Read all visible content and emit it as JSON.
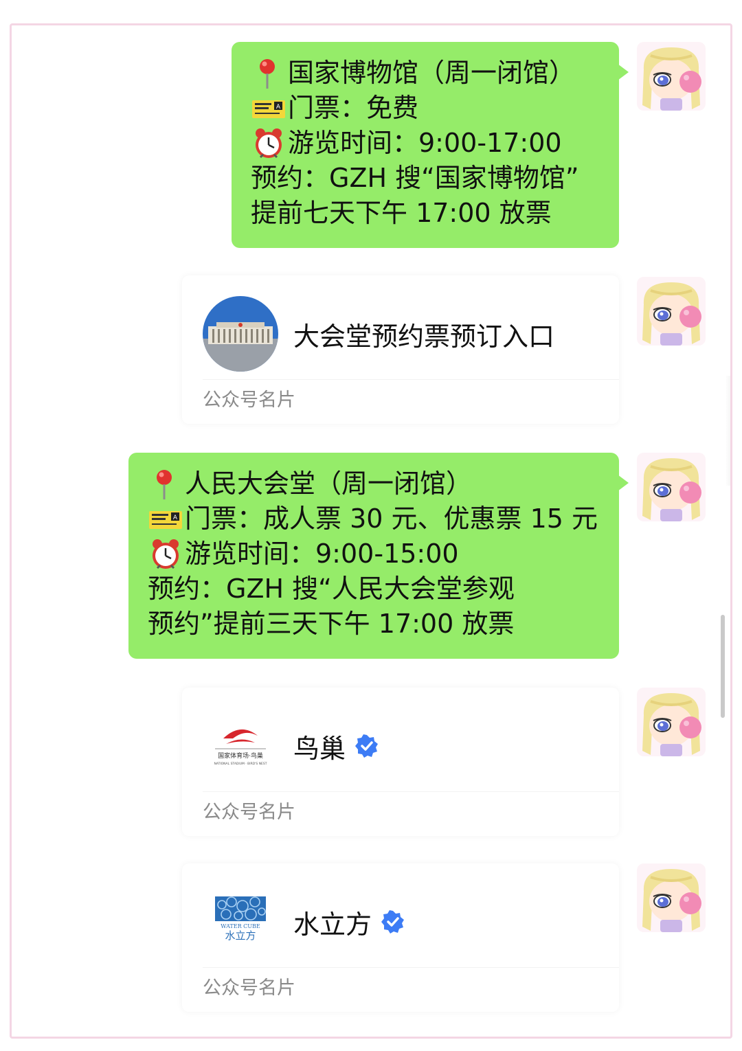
{
  "messages": [
    {
      "type": "text",
      "lines": [
        {
          "icon": "round-pushpin",
          "text": "国家博物馆（周一闭馆）"
        },
        {
          "icon": "ticket",
          "text": "门票：免费"
        },
        {
          "icon": "alarm-clock",
          "text": "游览时间：9:00-17:00"
        },
        {
          "icon": "",
          "text": "预约：GZH 搜“国家博物馆”"
        },
        {
          "icon": "",
          "text": "提前七天下午 17:00 放票"
        }
      ]
    },
    {
      "type": "card",
      "title": "大会堂预约票预订入口",
      "logo": "great-hall-photo",
      "verified": false,
      "footer": "公众号名片"
    },
    {
      "type": "text",
      "lines": [
        {
          "icon": "round-pushpin",
          "text": "人民大会堂（周一闭馆）"
        },
        {
          "icon": "ticket",
          "text": "门票：成人票 30 元、优惠票 15 元"
        },
        {
          "icon": "alarm-clock",
          "text": "游览时间：9:00-15:00"
        },
        {
          "icon": "",
          "text": "预约：GZH 搜“人民大会堂参观"
        },
        {
          "icon": "",
          "text": "预约”提前三天下午 17:00 放票"
        }
      ]
    },
    {
      "type": "card",
      "title": "鸟巢",
      "logo": "birds-nest-logo",
      "logo_text": "国家体育场·鸟巢",
      "logo_subtext": "NATIONAL STADIUM · BIRD'S NEST",
      "verified": true,
      "footer": "公众号名片"
    },
    {
      "type": "card",
      "title": "水立方",
      "logo": "water-cube-logo",
      "logo_text": "WATER CUBE",
      "logo_subtext": "水立方",
      "verified": true,
      "footer": "公众号名片"
    }
  ],
  "colors": {
    "bubble": "#95ec69",
    "verified": "#3d7cf5",
    "footer_text": "#8a8a8a"
  }
}
